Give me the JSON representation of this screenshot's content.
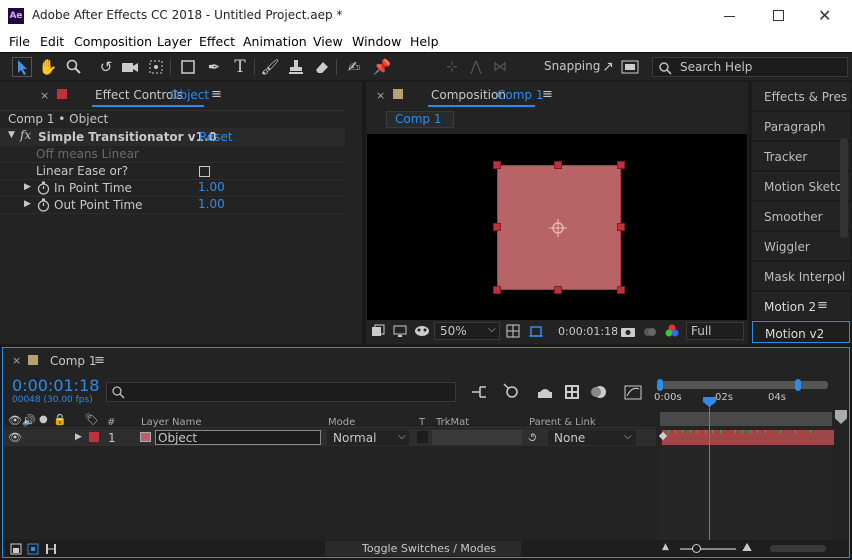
{
  "window": {
    "title": "Adobe After Effects CC 2018 - Untitled Project.aep *",
    "app_badge": "Ae"
  },
  "menu": [
    "File",
    "Edit",
    "Composition",
    "Layer",
    "Effect",
    "Animation",
    "View",
    "Window",
    "Help"
  ],
  "toolbar": {
    "snapping_label": "Snapping",
    "search_placeholder": "Search Help"
  },
  "effect_controls": {
    "tab_title": "Effect Controls",
    "tab_target": "Object",
    "breadcrumb": "Comp 1 • Object",
    "effect_name": "Simple Transitionator v1.0",
    "reset_label": "Reset",
    "note": "Off means Linear",
    "linear_ease_label": "Linear Ease or?",
    "in_point": {
      "label": "In Point Time",
      "value": "1.00"
    },
    "out_point": {
      "label": "Out Point Time",
      "value": "1.00"
    }
  },
  "composition": {
    "tab_title": "Composition",
    "tab_target": "Comp 1",
    "sub_tab": "Comp 1",
    "zoom": "50%",
    "timecode": "0:00:01:18",
    "resolution": "Full"
  },
  "right_panels": [
    "Effects & Pres",
    "Paragraph",
    "Tracker",
    "Motion Sketch",
    "Smoother",
    "Wiggler",
    "Mask Interpol",
    "Motion 2",
    "Motion v2"
  ],
  "timeline": {
    "tab_title": "Comp 1",
    "timecode": "0:00:01:18",
    "fps_info": "00048 (30.00 fps)",
    "headers": {
      "hash": "#",
      "layer_name": "Layer Name",
      "mode": "Mode",
      "t": "T",
      "trkmat": "TrkMat",
      "parent": "Parent & Link"
    },
    "ruler": [
      "0:00s",
      "02s",
      "04s"
    ],
    "layer": {
      "index": "1",
      "name": "Object",
      "mode": "Normal",
      "parent": "None"
    },
    "footer_label": "Toggle Switches / Modes"
  },
  "colors": {
    "accent": "#2d8ceb",
    "layer_red": "#c0313a",
    "shape_fill": "#b86466"
  }
}
